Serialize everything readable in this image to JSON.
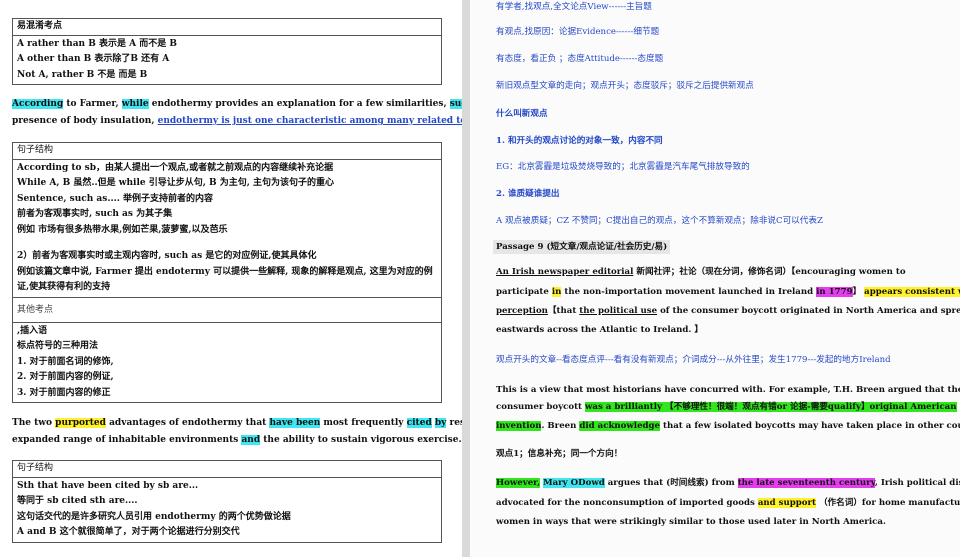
{
  "left": {
    "box1": {
      "title": "易混淆考点",
      "lines": [
        "A rather than B 表示是 A 而不是 B",
        "A other than B 表示除了B 还有 A",
        "Not A, rather B 不是 而是 B"
      ]
    },
    "para1": {
      "w1": "According",
      "w2": " to Farmer, ",
      "w3": "while",
      "w4": " endothermy provides an explanation for a few similarities, ",
      "w5": "such as",
      "w6": " the",
      "l2a": "presence of body insulation, ",
      "l2b": "endothermy is just one characteristic among many related to parental care."
    },
    "box2": {
      "title": "句子结构",
      "lines": [
        "According to sb，由某人提出一个观点,或者就之前观点的内容继续补充论据",
        "While A, B 虽然..但是 while 引导让步从句, B 为主句, 主句为该句子的重心",
        "Sentence, such as.... 举例子支持前者的内容",
        "前者为客观事实时, such as 为其子集",
        "例如 市场有很多热带水果,例如芒果,菠萝蜜,以及芭乐",
        "",
        "2）前者为客观事实时或主观内容时, such as 是它的对应例证,使其具体化",
        "例如该篇文章中说, Farmer 提出 endotermy 可以提供一些解释, 现象的解释是观点, 这里为对应的例",
        "证,使其获得有利的支持"
      ],
      "sub_title": "其他考点",
      "sub_lines": [
        ",插入语",
        "标点符号的三种用法",
        "1. 对于前面名词的修饰,",
        "2. 对于前面内容的例证,",
        "3. 对于前面内容的修正"
      ]
    },
    "para2": {
      "a": "The two ",
      "b": "purported",
      "c": " advantages of endothermy that ",
      "d": "have been",
      "e": " most frequently ",
      "f": "cited",
      "g": " ",
      "h": "by",
      "i": " researchers ",
      "j": "are",
      "k": " an",
      "l2a": "expanded range of inhabitable environments ",
      "l2b": "and",
      "l2c": " the ability to sustain vigorous exercise."
    },
    "box3": {
      "title": "句子结构",
      "lines": [
        "Sth that have been cited by sb are...",
        "等同于 sb cited sth are....",
        "这句话交代的是许多研究人员引用 endothermy 的两个优势做论据",
        "A and B 这个就很简单了，对于两个论据进行分别交代"
      ]
    }
  },
  "right": {
    "l1": "有学者,找观点,全文论点View------主旨题",
    "l2": "有观点,找原因：论据Evidence------细节题",
    "l3": "有态度，看正负 ；态度Attitude------态度题",
    "l4": "新旧观点型文章的走向；观点开头；态度驳斥；驳斥之后提供新观点",
    "l5": "什么叫新观点",
    "l6": "1. 和开头的观点讨论的对象一致，内容不同",
    "l7": "EG：北京雾霾是垃圾焚烧导致的；北京雾霾是汽车尾气排放导致的",
    "l8": "2. 谁质疑谁提出",
    "l9": "A 观点被质疑；CZ 不赞同；C提出自己的观点，这个不算新观点；除非说C可以代表Z",
    "passage": "Passage 9 (短文章/观点论证/社会历史/易)",
    "p1": {
      "a": "An Irish newspaper editorial",
      "b": " 新闻社评；社论（现在分词，修饰名词）【encouraging women to"
    },
    "p2": {
      "a": "participate ",
      "b": "in",
      "c": " the non-importation movement launched in Ireland ",
      "d": "in 1779",
      "e": "】 ",
      "f": "appears consistent with",
      "g": " ",
      "h": "a"
    },
    "p3": {
      "a": "perception",
      "b": "【that ",
      "c": "the political use",
      "d": " of the consumer boycott originated in North America and spread"
    },
    "p4": "eastwards across the Atlantic to Ireland. 】",
    "note1": "观点开头的文章--看态度点评---看有没有新观点；介词成分---从外往里；发生1779---发起的地方Ireland",
    "p5": "This is a view that most historians have concurred with. For example, T.H. Breen argued that the",
    "p6": {
      "a": "consumer boycott ",
      "b": "was a brilliantly 【不够理性！很端！观点有错or 论据-需要qualify】original American"
    },
    "p7": {
      "a": "invention",
      "b": ". Breen ",
      "c": "did acknowledge",
      "d": " that a few isolated boycotts may have taken place in other countries."
    },
    "note2": "观点1；信息补充；同一个方向！",
    "p8": {
      "a": "However,",
      "b": " ",
      "c": "Mary ODowd",
      "d": " argues that (时间线索) from ",
      "e": "the late seventeenth century",
      "f": ", Irish political discourse"
    },
    "p9": {
      "a": "advocated for the nonconsumption of imported goods ",
      "b": "and support",
      "c": " （作名词）for home manufactures by"
    },
    "p10": "women in ways that were strikingly similar to those used later in North America."
  }
}
